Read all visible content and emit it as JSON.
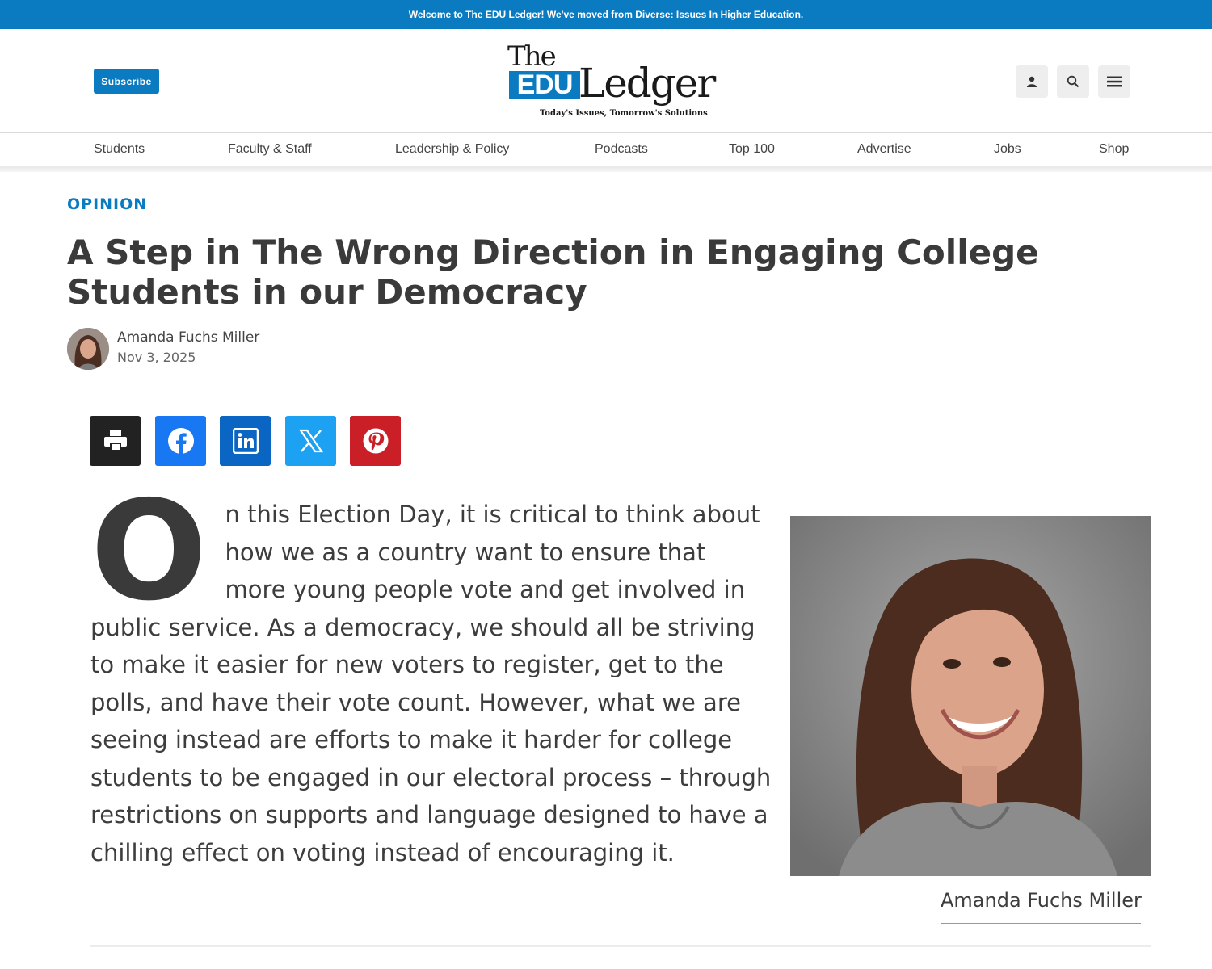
{
  "banner": {
    "text": "Welcome to The EDU Ledger! We've moved from Diverse: Issues In Higher Education."
  },
  "header": {
    "subscribe_label": "Subscribe",
    "logo": {
      "the": "The",
      "edu": "EDU",
      "ledger": "Ledger",
      "tagline": "Today's Issues, Tomorrow's Solutions"
    },
    "icons": [
      "user-icon",
      "search-icon",
      "menu-icon"
    ]
  },
  "nav": {
    "items": [
      {
        "label": "Students"
      },
      {
        "label": "Faculty & Staff"
      },
      {
        "label": "Leadership & Policy"
      },
      {
        "label": "Podcasts"
      },
      {
        "label": "Top 100"
      },
      {
        "label": "Advertise"
      },
      {
        "label": "Jobs"
      },
      {
        "label": "Shop"
      }
    ]
  },
  "article": {
    "category": "OPINION",
    "title": "A Step in The Wrong Direction in Engaging College Students in our Democracy",
    "author": "Amanda Fuchs Miller",
    "date": "Nov 3, 2025",
    "share": [
      "print-icon",
      "facebook-icon",
      "linkedin-icon",
      "x-icon",
      "pinterest-icon"
    ],
    "dropcap": "O",
    "body": "n this Election Day, it is critical to think about how we as a country want to ensure that more young people vote and get involved in public service.  As a democracy, we should all be striving to make it easier for new voters to register, get to the polls, and have their vote count.  However, what we are seeing instead are efforts to make it harder for college students to be engaged in our electoral process – through restrictions on supports and language designed to have a chilling effect on voting instead of encouraging it.",
    "photo_caption": "Amanda Fuchs Miller"
  },
  "colors": {
    "brand_blue": "#0a7bc1",
    "facebook": "#1877f2",
    "linkedin": "#0a66c2",
    "x": "#1da1f2",
    "pinterest": "#cb1f27",
    "print": "#222222"
  }
}
